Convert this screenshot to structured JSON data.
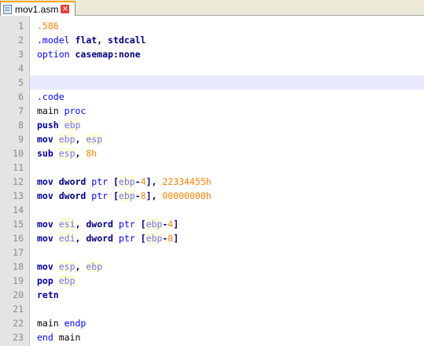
{
  "tab": {
    "filename": "mov1.asm",
    "close_glyph": "✕"
  },
  "editor": {
    "current_line": 5,
    "lines": [
      {
        "n": "1",
        "tokens": [
          {
            "t": ".586",
            "c": "num"
          }
        ]
      },
      {
        "n": "2",
        "tokens": [
          {
            "t": ".model",
            "c": "dir"
          },
          {
            "t": " flat, stdcall",
            "c": "type"
          }
        ]
      },
      {
        "n": "3",
        "tokens": [
          {
            "t": "option",
            "c": "dir"
          },
          {
            "t": " casemap:none",
            "c": "type"
          }
        ]
      },
      {
        "n": "4",
        "tokens": []
      },
      {
        "n": "5",
        "tokens": []
      },
      {
        "n": "6",
        "tokens": [
          {
            "t": ".code",
            "c": "dir"
          }
        ]
      },
      {
        "n": "7",
        "tokens": [
          {
            "t": "main ",
            "c": "id"
          },
          {
            "t": "proc",
            "c": "dir"
          }
        ]
      },
      {
        "n": "8",
        "tokens": [
          {
            "t": "push",
            "c": "op"
          },
          {
            "t": " ",
            "c": "plain"
          },
          {
            "t": "ebp",
            "c": "reg"
          }
        ]
      },
      {
        "n": "9",
        "tokens": [
          {
            "t": "mov",
            "c": "op"
          },
          {
            "t": " ",
            "c": "plain"
          },
          {
            "t": "ebp",
            "c": "reg"
          },
          {
            "t": ", ",
            "c": "pun"
          },
          {
            "t": "esp",
            "c": "reg"
          }
        ]
      },
      {
        "n": "10",
        "tokens": [
          {
            "t": "sub",
            "c": "op"
          },
          {
            "t": " ",
            "c": "plain"
          },
          {
            "t": "esp",
            "c": "reg"
          },
          {
            "t": ", ",
            "c": "pun"
          },
          {
            "t": "8h",
            "c": "num"
          }
        ]
      },
      {
        "n": "11",
        "tokens": []
      },
      {
        "n": "12",
        "tokens": [
          {
            "t": "mov",
            "c": "op"
          },
          {
            "t": " ",
            "c": "plain"
          },
          {
            "t": "dword",
            "c": "type"
          },
          {
            "t": " ",
            "c": "plain"
          },
          {
            "t": "ptr",
            "c": "ptr"
          },
          {
            "t": " [",
            "c": "pun"
          },
          {
            "t": "ebp",
            "c": "reg"
          },
          {
            "t": "-",
            "c": "pun"
          },
          {
            "t": "4",
            "c": "num"
          },
          {
            "t": "], ",
            "c": "pun"
          },
          {
            "t": "22334455h",
            "c": "num"
          }
        ]
      },
      {
        "n": "13",
        "tokens": [
          {
            "t": "mov",
            "c": "op"
          },
          {
            "t": " ",
            "c": "plain"
          },
          {
            "t": "dword",
            "c": "type"
          },
          {
            "t": " ",
            "c": "plain"
          },
          {
            "t": "ptr",
            "c": "ptr"
          },
          {
            "t": " [",
            "c": "pun"
          },
          {
            "t": "ebp",
            "c": "reg"
          },
          {
            "t": "-",
            "c": "pun"
          },
          {
            "t": "8",
            "c": "num"
          },
          {
            "t": "], ",
            "c": "pun"
          },
          {
            "t": "00000000h",
            "c": "num"
          }
        ]
      },
      {
        "n": "14",
        "tokens": []
      },
      {
        "n": "15",
        "tokens": [
          {
            "t": "mov",
            "c": "op"
          },
          {
            "t": " ",
            "c": "plain"
          },
          {
            "t": "esi",
            "c": "reg"
          },
          {
            "t": ", ",
            "c": "pun"
          },
          {
            "t": "dword",
            "c": "type"
          },
          {
            "t": " ",
            "c": "plain"
          },
          {
            "t": "ptr",
            "c": "ptr"
          },
          {
            "t": " [",
            "c": "pun"
          },
          {
            "t": "ebp",
            "c": "reg"
          },
          {
            "t": "-",
            "c": "pun"
          },
          {
            "t": "4",
            "c": "num"
          },
          {
            "t": "]",
            "c": "pun"
          }
        ]
      },
      {
        "n": "16",
        "tokens": [
          {
            "t": "mov",
            "c": "op"
          },
          {
            "t": " ",
            "c": "plain"
          },
          {
            "t": "edi",
            "c": "reg"
          },
          {
            "t": ", ",
            "c": "pun"
          },
          {
            "t": "dword",
            "c": "type"
          },
          {
            "t": " ",
            "c": "plain"
          },
          {
            "t": "ptr",
            "c": "ptr"
          },
          {
            "t": " [",
            "c": "pun"
          },
          {
            "t": "ebp",
            "c": "reg"
          },
          {
            "t": "-",
            "c": "pun"
          },
          {
            "t": "8",
            "c": "num"
          },
          {
            "t": "]",
            "c": "pun"
          }
        ]
      },
      {
        "n": "17",
        "tokens": []
      },
      {
        "n": "18",
        "tokens": [
          {
            "t": "mov",
            "c": "op"
          },
          {
            "t": " ",
            "c": "plain"
          },
          {
            "t": "esp",
            "c": "reg"
          },
          {
            "t": ", ",
            "c": "pun"
          },
          {
            "t": "ebp",
            "c": "reg"
          }
        ]
      },
      {
        "n": "19",
        "tokens": [
          {
            "t": "pop",
            "c": "op"
          },
          {
            "t": " ",
            "c": "plain"
          },
          {
            "t": "ebp",
            "c": "reg"
          }
        ]
      },
      {
        "n": "20",
        "tokens": [
          {
            "t": "retn",
            "c": "op"
          }
        ]
      },
      {
        "n": "21",
        "tokens": []
      },
      {
        "n": "22",
        "tokens": [
          {
            "t": "main ",
            "c": "id"
          },
          {
            "t": "endp",
            "c": "dir"
          }
        ]
      },
      {
        "n": "23",
        "tokens": [
          {
            "t": "end",
            "c": "dir"
          },
          {
            "t": " main",
            "c": "id"
          }
        ]
      }
    ]
  }
}
